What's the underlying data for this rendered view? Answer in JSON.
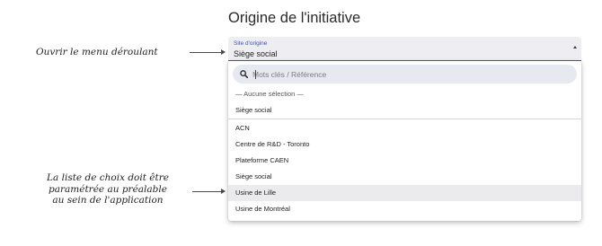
{
  "section": {
    "title": "Origine de l'initiative"
  },
  "field": {
    "label": "Site d'origine",
    "value": "Siège social",
    "accent_color": "#3f51b5"
  },
  "search": {
    "icon": "search-icon",
    "placeholder": "Mots clés / Référence"
  },
  "options": {
    "no_selection": "— Aucune sélection —",
    "selected": "Siège social",
    "items": [
      "ACN",
      "Centre de R&D - Toronto",
      "Plateforme CAEN",
      "Siège social",
      "Usine de Lille",
      "Usine de Montréal"
    ],
    "hovered": "Usine de Lille"
  },
  "annotations": {
    "open_menu": "Ouvrir le menu déroulant",
    "choices_line1": "La liste de choix doit être",
    "choices_line2": "paramétrée au préalable",
    "choices_line3": "au sein de l'application"
  }
}
